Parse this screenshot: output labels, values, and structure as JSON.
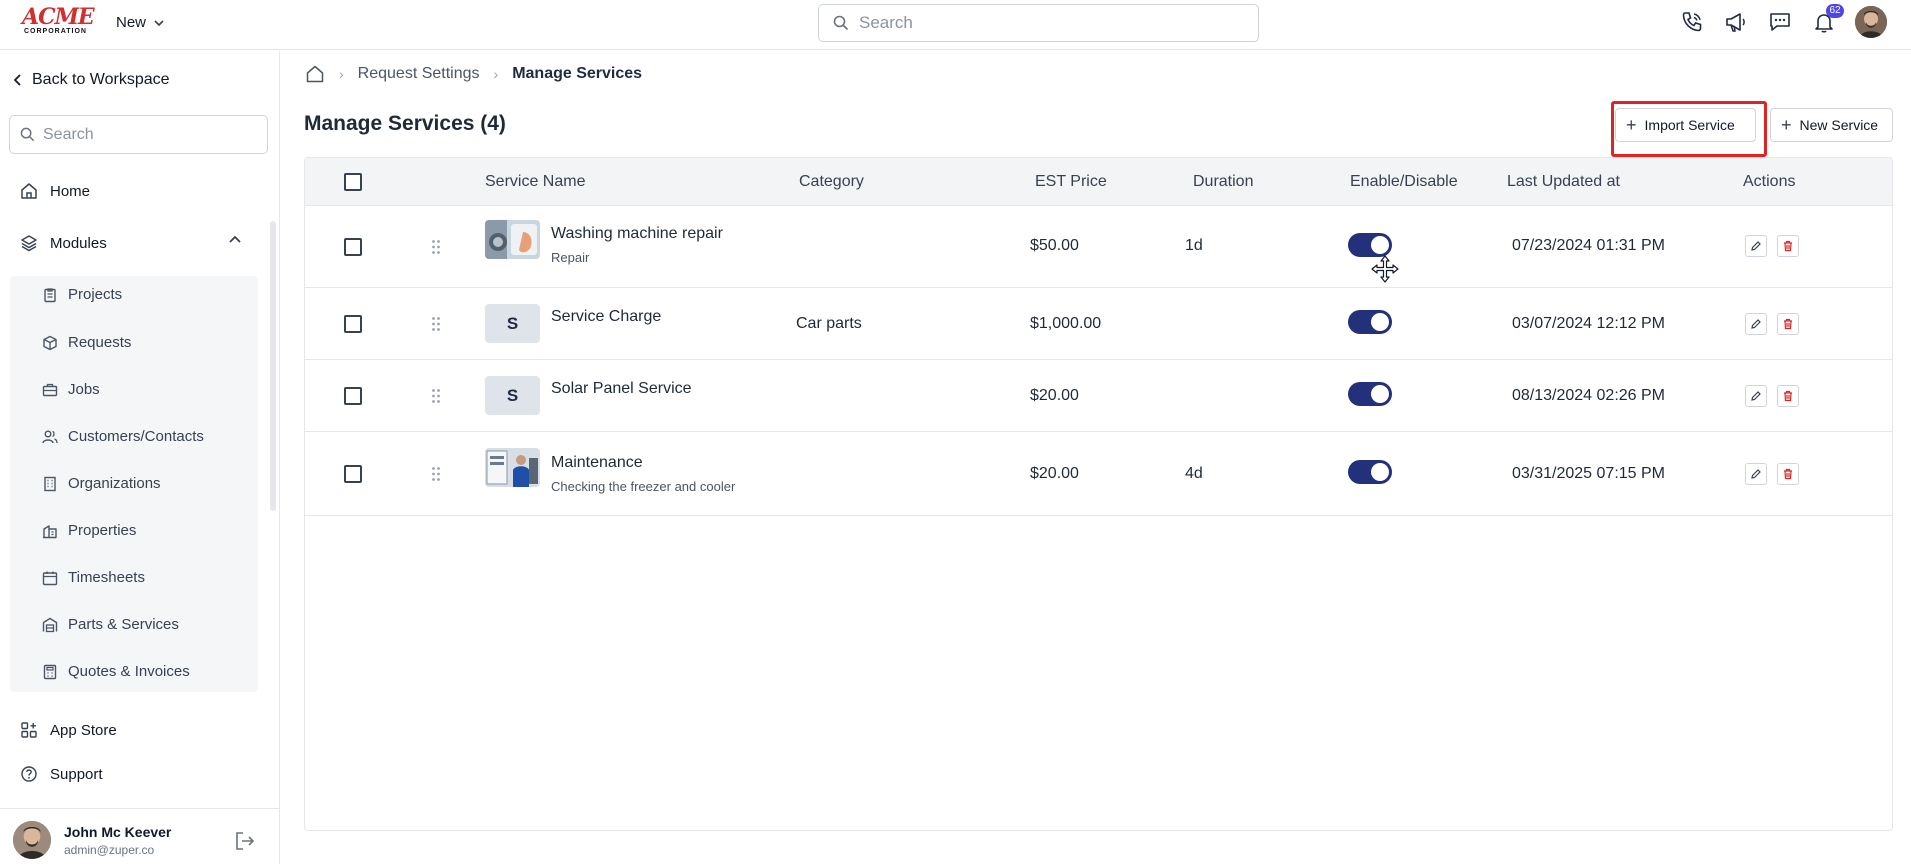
{
  "brand": {
    "logo_line1": "ACME",
    "logo_line2": "CORPORATION",
    "color": "#d32f2f"
  },
  "topbar": {
    "new_label": "New",
    "search_placeholder": "Search",
    "notification_count": "62",
    "icons": [
      "phone-icon",
      "megaphone-icon",
      "chat-icon",
      "bell-icon",
      "user-avatar"
    ]
  },
  "sidebar": {
    "back_label": "Back to Workspace",
    "search_placeholder": "Search",
    "home_label": "Home",
    "modules_label": "Modules",
    "modules": [
      {
        "label": "Projects",
        "icon": "clipboard-icon"
      },
      {
        "label": "Requests",
        "icon": "box-icon"
      },
      {
        "label": "Jobs",
        "icon": "briefcase-icon"
      },
      {
        "label": "Customers/Contacts",
        "icon": "users-icon"
      },
      {
        "label": "Organizations",
        "icon": "building-icon"
      },
      {
        "label": "Properties",
        "icon": "property-icon"
      },
      {
        "label": "Timesheets",
        "icon": "calendar-icon"
      },
      {
        "label": "Parts & Services",
        "icon": "warehouse-icon"
      },
      {
        "label": "Quotes & Invoices",
        "icon": "calculator-icon"
      }
    ],
    "app_store_label": "App Store",
    "support_label": "Support",
    "user": {
      "name": "John Mc Keever",
      "email": "admin@zuper.co"
    }
  },
  "breadcrumb": {
    "items": [
      "Request Settings",
      "Manage Services"
    ]
  },
  "page": {
    "title": "Manage Services (4)",
    "import_label": "Import Service",
    "new_label": "New Service"
  },
  "table": {
    "headers": [
      "Service Name",
      "Category",
      "EST Price",
      "Duration",
      "Enable/Disable",
      "Last Updated at",
      "Actions"
    ],
    "rows": [
      {
        "name": "Washing machine repair",
        "subtitle": "Repair",
        "category": "",
        "price": "$50.00",
        "duration": "1d",
        "enabled": true,
        "updated": "07/23/2024 01:31 PM",
        "thumb": "image"
      },
      {
        "name": "Service Charge",
        "subtitle": "",
        "category": "Car parts",
        "price": "$1,000.00",
        "duration": "",
        "enabled": true,
        "updated": "03/07/2024 12:12 PM",
        "thumb": "S"
      },
      {
        "name": "Solar Panel Service",
        "subtitle": "",
        "category": "",
        "price": "$20.00",
        "duration": "",
        "enabled": true,
        "updated": "08/13/2024 02:26 PM",
        "thumb": "S"
      },
      {
        "name": "Maintenance",
        "subtitle": "Checking the freezer and cooler",
        "category": "",
        "price": "$20.00",
        "duration": "4d",
        "enabled": true,
        "updated": "03/31/2025 07:15 PM",
        "thumb": "image"
      }
    ]
  },
  "colors": {
    "accent": "#23307a",
    "danger": "#e02424",
    "highlight": "#e02424"
  }
}
